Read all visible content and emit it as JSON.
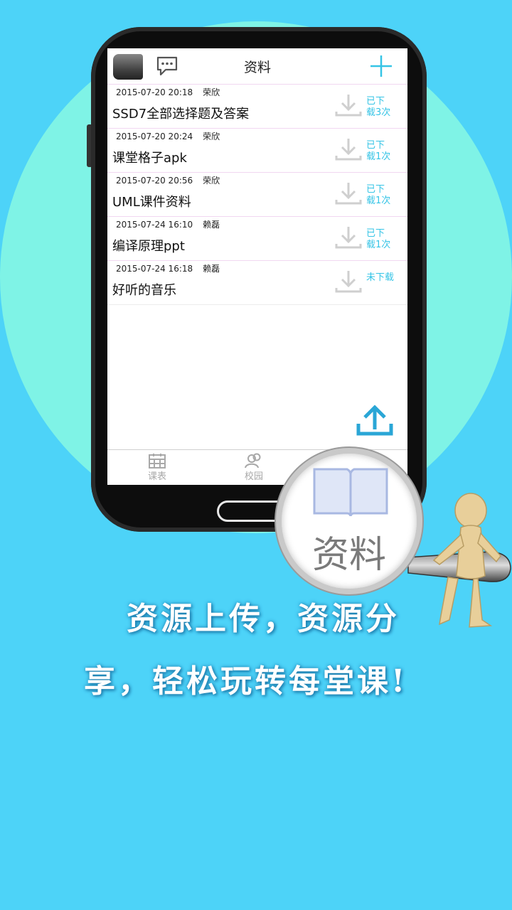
{
  "header": {
    "title": "资料"
  },
  "items": [
    {
      "date": "2015-07-20 20:18",
      "author": "荣欣",
      "name": "SSD7全部选择题及答案",
      "status_line1": "已下",
      "status_line2": "载3次"
    },
    {
      "date": "2015-07-20 20:24",
      "author": "荣欣",
      "name": "课堂格子apk",
      "status_line1": "已下",
      "status_line2": "载1次"
    },
    {
      "date": "2015-07-20 20:56",
      "author": "荣欣",
      "name": "UML课件资料",
      "status_line1": "已下",
      "status_line2": "载1次"
    },
    {
      "date": "2015-07-24 16:10",
      "author": "赖磊",
      "name": "编译原理ppt",
      "status_line1": "已下",
      "status_line2": "载1次"
    },
    {
      "date": "2015-07-24 16:18",
      "author": "赖磊",
      "name": "好听的音乐",
      "status_line1": "未下载",
      "status_line2": ""
    }
  ],
  "tabs": [
    {
      "label": "课表"
    },
    {
      "label": "校园"
    }
  ],
  "magnifier": {
    "label": "资料"
  },
  "slogan": {
    "line1": "资源上传，资源分",
    "line2": "享，轻松玩转每堂课!"
  },
  "colors": {
    "background": "#4dd3f8",
    "circle": "#7ff3e6",
    "accent": "#35c4e6"
  }
}
